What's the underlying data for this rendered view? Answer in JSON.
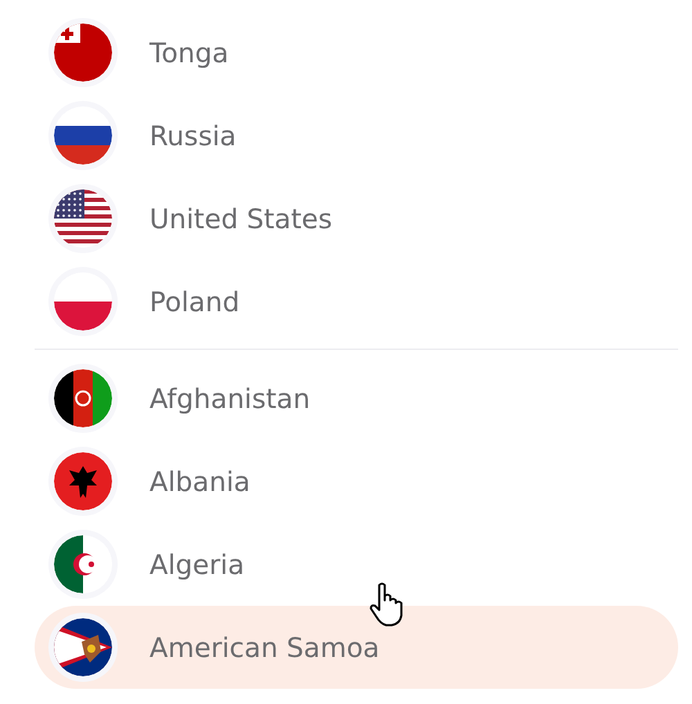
{
  "groups": [
    {
      "items": [
        {
          "name": "Tonga",
          "selected": false
        },
        {
          "name": "Russia",
          "selected": false
        },
        {
          "name": "United States",
          "selected": false
        },
        {
          "name": "Poland",
          "selected": false
        }
      ]
    },
    {
      "items": [
        {
          "name": "Afghanistan",
          "selected": false
        },
        {
          "name": "Albania",
          "selected": false
        },
        {
          "name": "Algeria",
          "selected": false
        },
        {
          "name": "American Samoa",
          "selected": true
        }
      ]
    }
  ]
}
